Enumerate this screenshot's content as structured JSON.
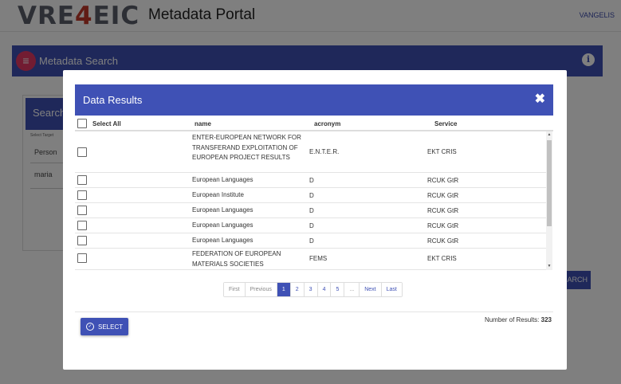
{
  "app": {
    "logo_prefix": "VRE",
    "logo_accent": "4",
    "logo_suffix": "EIC",
    "title": "Metadata Portal",
    "user": "VANGELIS"
  },
  "search_bar": {
    "title": "Metadata Search",
    "info_symbol": "i",
    "menu_symbol": "≡"
  },
  "background_panel": {
    "heading": "Search",
    "select_target": "Select Target",
    "field1": "Person",
    "field2": "maria",
    "search_button": "ARCH"
  },
  "modal": {
    "title": "Data Results",
    "close_symbol": "✖",
    "columns": {
      "select_all": "Select All",
      "name": "name",
      "acronym": "acronym",
      "service": "Service"
    },
    "rows": [
      {
        "name": "ENTER-EUROPEAN NETWORK FOR TRANSFERAND EXPLOITATION OF EUROPEAN PROJECT RESULTS",
        "acronym": "E.N.T.E.R.",
        "service": "EKT CRIS"
      },
      {
        "name": "European Languages",
        "acronym": "D",
        "service": "RCUK GtR"
      },
      {
        "name": "European Institute",
        "acronym": "D",
        "service": "RCUK GtR"
      },
      {
        "name": "European Languages",
        "acronym": "D",
        "service": "RCUK GtR"
      },
      {
        "name": "European Languages",
        "acronym": "D",
        "service": "RCUK GtR"
      },
      {
        "name": "European Languages",
        "acronym": "D",
        "service": "RCUK GtR"
      },
      {
        "name": "FEDERATION OF EUROPEAN MATERIALS SOCIETIES",
        "acronym": "FEMS",
        "service": "EKT CRIS"
      }
    ],
    "pagination": {
      "first": "First",
      "previous": "Previous",
      "pages": [
        "1",
        "2",
        "3",
        "4",
        "5"
      ],
      "ellipsis": "...",
      "next": "Next",
      "last": "Last",
      "current": "1"
    },
    "results_label": "Number of Results:",
    "results_count": "323",
    "select_button": "SELECT",
    "select_icon": "✓"
  },
  "colors": {
    "primary": "#3f51b5",
    "menu_accent": "#e53965",
    "logo_accent": "#c0392b"
  }
}
